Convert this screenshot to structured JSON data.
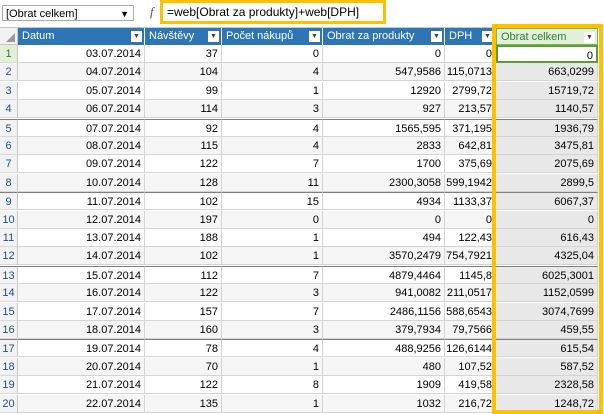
{
  "formula_bar": {
    "name_box": "[Obrat celkem]",
    "fx": "f",
    "formula": "=web[Obrat za produkty]+web[DPH]"
  },
  "columns": [
    "Datum",
    "Návštěvy",
    "Počet nákupů",
    "Obrat za produkty",
    "DPH",
    "Obrat celkem"
  ],
  "rows": [
    [
      "03.07.2014",
      "37",
      "0",
      "0",
      "0",
      "0"
    ],
    [
      "04.07.2014",
      "104",
      "4",
      "547,9586",
      "115,0713",
      "663,0299"
    ],
    [
      "05.07.2014",
      "99",
      "1",
      "12920",
      "2799,72",
      "15719,72"
    ],
    [
      "06.07.2014",
      "114",
      "3",
      "927",
      "213,57",
      "1140,57"
    ],
    [
      "07.07.2014",
      "92",
      "4",
      "1565,595",
      "371,195",
      "1936,79"
    ],
    [
      "08.07.2014",
      "115",
      "4",
      "2833",
      "642,81",
      "3475,81"
    ],
    [
      "09.07.2014",
      "122",
      "7",
      "1700",
      "375,69",
      "2075,69"
    ],
    [
      "10.07.2014",
      "128",
      "11",
      "2300,3058",
      "599,1942",
      "2899,5"
    ],
    [
      "11.07.2014",
      "102",
      "15",
      "4934",
      "1133,37",
      "6067,37"
    ],
    [
      "12.07.2014",
      "197",
      "0",
      "0",
      "0",
      "0"
    ],
    [
      "13.07.2014",
      "188",
      "1",
      "494",
      "122,43",
      "616,43"
    ],
    [
      "14.07.2014",
      "102",
      "1",
      "3570,2479",
      "754,7921",
      "4325,04"
    ],
    [
      "15.07.2014",
      "112",
      "7",
      "4879,4464",
      "1145,8",
      "6025,3001"
    ],
    [
      "16.07.2014",
      "122",
      "3",
      "941,0082",
      "211,0517",
      "1152,0599"
    ],
    [
      "17.07.2014",
      "157",
      "7",
      "2486,1156",
      "588,6543",
      "3074,7699"
    ],
    [
      "18.07.2014",
      "160",
      "3",
      "379,7934",
      "79,7566",
      "459,55"
    ],
    [
      "19.07.2014",
      "78",
      "4",
      "488,9256",
      "126,6144",
      "615,54"
    ],
    [
      "20.07.2014",
      "70",
      "1",
      "480",
      "107,52",
      "587,52"
    ],
    [
      "21.07.2014",
      "122",
      "8",
      "1909",
      "419,58",
      "2328,58"
    ],
    [
      "22.07.2014",
      "135",
      "1",
      "1032",
      "216,72",
      "1248,72"
    ]
  ],
  "colors": {
    "header": "#2e75b6",
    "highlight": "#ffc000",
    "selected": "#5aa02c"
  }
}
